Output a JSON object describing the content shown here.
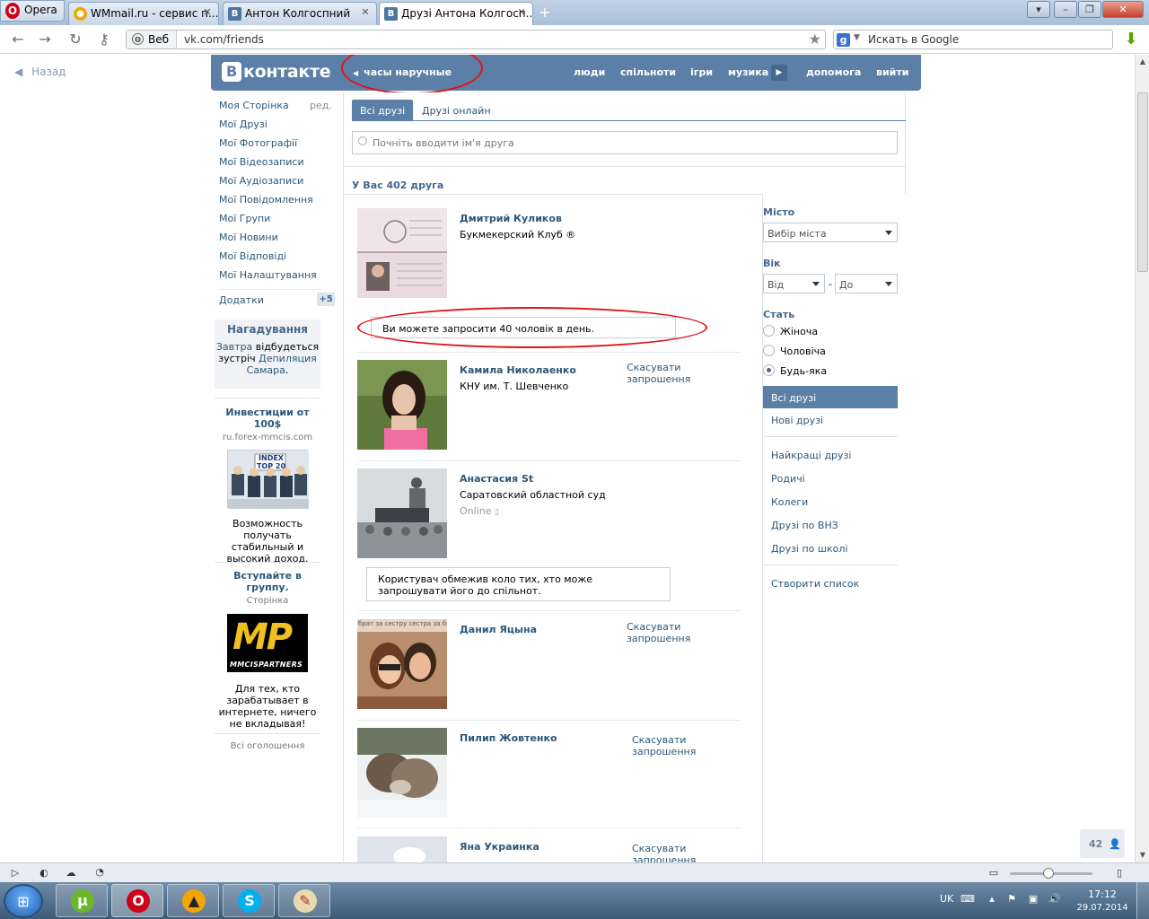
{
  "browser": {
    "menu_label": "Opera",
    "tabs": [
      {
        "title": "WMmail.ru - сервис п...",
        "favicon": "wmmail-favicon"
      },
      {
        "title": "Антон Колгоспний",
        "favicon": "vk-favicon"
      },
      {
        "title": "Друзі Антона Колгосп...",
        "favicon": "vk-favicon"
      }
    ],
    "address_scope": "Веб",
    "url": "vk.com/friends",
    "search_placeholder": "Искать в Google"
  },
  "page": {
    "back_label": "Назад",
    "logo_text": "контакте",
    "status": "часы наручные",
    "top_nav": [
      "люди",
      "спільноти",
      "ігри",
      "музика",
      "допомога",
      "вийти"
    ],
    "left_menu": {
      "items": [
        "Моя Сторінка",
        "Мої Друзі",
        "Мої Фотографії",
        "Мої Відеозаписи",
        "Мої Аудіозаписи",
        "Мої Повідомлення",
        "Мої Групи",
        "Мої Новини",
        "Мої Відповіді",
        "Мої Налаштування"
      ],
      "edit_label": "ред.",
      "apps_label": "Додатки",
      "apps_badge": "+5"
    },
    "reminder": {
      "title": "Нагадування",
      "when_link": "Завтра",
      "text_mid": " відбудеться зустріч ",
      "event_link": "Депиляция Самара",
      "tail": "."
    },
    "ads": [
      {
        "title": "Инвестиции от 100$",
        "sub": "ru.forex-mmcis.com",
        "image_caption": "INDEX TOP 20",
        "text": "Возможность получать стабильный и высокий доход."
      },
      {
        "title": "Вступайте в группу.",
        "sub": "Сторінка",
        "image_caption": "MP",
        "image_caption2": "MMCISPARTNERS",
        "text": "Для тех, кто зарабатывает в интернете, ничего не вкладывая!"
      }
    ],
    "all_ads": "Всі оголошення",
    "tabs": [
      "Всі друзі",
      "Друзі онлайн"
    ],
    "search_placeholder": "Почніть вводити ім'я друга",
    "friends_count": "У Вас 402 друга",
    "friends": [
      {
        "name": "Дмитрий Куликов",
        "info": "Букмекерский Клуб ®",
        "notice": "Ви можете запросити 40 чоловік в день."
      },
      {
        "name": "Камила Николаенко",
        "info": "КНУ им. Т. Шевченко",
        "action": "Скасувати запрошення"
      },
      {
        "name": "Анастасия St",
        "info": "Саратовский областной суд",
        "online": "Online",
        "notice": "Користувач обмежив коло тих, хто може запрошувати його до спільнот."
      },
      {
        "name": "Данил Яцына",
        "action": "Скасувати запрошення",
        "photo_caption": "брат за сестру сестра за бра"
      },
      {
        "name": "Пилип Жовтенко",
        "action": "Скасувати запрошення"
      },
      {
        "name": "Яна Украинка",
        "action": "Скасувати запрошення"
      }
    ],
    "filters": {
      "city_label": "Місто",
      "city_value": "Вибір міста",
      "age_label": "Вік",
      "age_from": "Від",
      "age_dash": "-",
      "age_to": "До",
      "sex_label": "Стать",
      "sex_options": [
        "Жіноча",
        "Чоловіча",
        "Будь-яка"
      ],
      "sex_selected": "Будь-яка",
      "menu": [
        "Всі друзі",
        "Нові друзі",
        "Найкращі друзі",
        "Родичі",
        "Колеги",
        "Друзі по ВНЗ",
        "Друзі по школі",
        "Створити список"
      ]
    },
    "im_counter": "42"
  },
  "taskbar": {
    "lang": "UK",
    "time": "17:12",
    "date": "29.07.2014"
  },
  "colors": {
    "vk_blue": "#5b7fa6",
    "link": "#2b587a",
    "annotation_red": "#e01018"
  }
}
